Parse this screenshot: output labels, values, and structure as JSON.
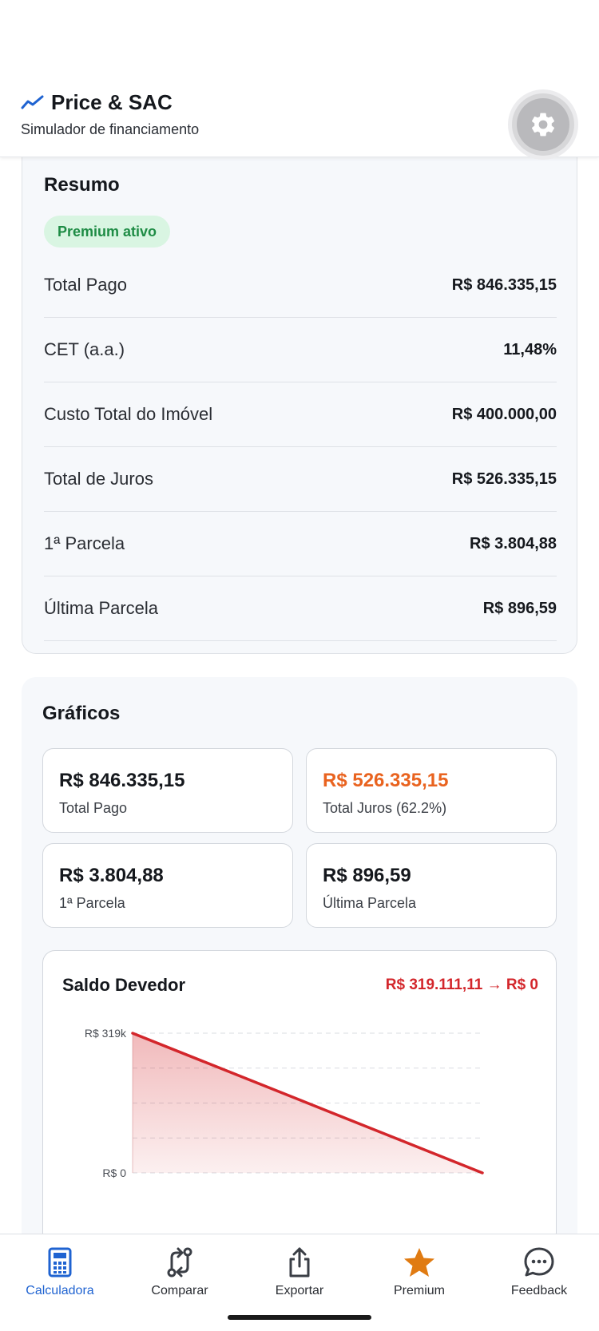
{
  "header": {
    "title": "Price & SAC",
    "subtitle": "Simulador de financiamento",
    "brand_icon": "trending-line-icon",
    "settings_icon": "gear-icon"
  },
  "resumo": {
    "title": "Resumo",
    "badge": "Premium ativo",
    "rows": [
      {
        "label": "Total Pago",
        "value": "R$ 846.335,15"
      },
      {
        "label": "CET (a.a.)",
        "value": "11,48%"
      },
      {
        "label": "Custo Total do Imóvel",
        "value": "R$ 400.000,00"
      },
      {
        "label": "Total de Juros",
        "value": "R$ 526.335,15"
      },
      {
        "label": "1ª Parcela",
        "value": "R$ 3.804,88"
      },
      {
        "label": "Última Parcela",
        "value": "R$ 896,59"
      }
    ]
  },
  "graficos": {
    "title": "Gráficos",
    "stats": [
      {
        "value": "R$ 846.335,15",
        "label": "Total Pago"
      },
      {
        "value": "R$ 526.335,15",
        "label": "Total Juros (62.2%)"
      },
      {
        "value": "R$ 3.804,88",
        "label": "1ª Parcela"
      },
      {
        "value": "R$ 896,59",
        "label": "Última Parcela"
      }
    ]
  },
  "chart_data": {
    "type": "area",
    "title": "Saldo Devedor",
    "range_text": "R$ 319.111,11 → R$ 0",
    "ytick_labels": [
      "R$ 319k",
      "R$ 0"
    ],
    "x": [
      0,
      1
    ],
    "values": [
      319111.11,
      0
    ],
    "ylim": [
      0,
      319111.11
    ],
    "grid": true,
    "color": "#d3262b"
  },
  "nav": {
    "items": [
      {
        "label": "Calculadora",
        "icon": "calculator-icon",
        "active": true
      },
      {
        "label": "Comparar",
        "icon": "compare-icon",
        "active": false
      },
      {
        "label": "Exportar",
        "icon": "share-icon",
        "active": false
      },
      {
        "label": "Premium",
        "icon": "star-icon",
        "active": false
      },
      {
        "label": "Feedback",
        "icon": "chat-bubble-icon",
        "active": false
      }
    ]
  },
  "colors": {
    "accent": "#1f63d1",
    "premium_green": "#1e8c45",
    "orange": "#e9631f",
    "red": "#d3262b",
    "star": "#e07b12"
  }
}
